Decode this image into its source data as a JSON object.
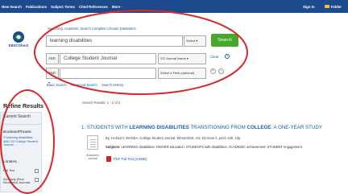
{
  "topnav": {
    "items": [
      "New Search",
      "Publications",
      "Subject Terms",
      "Cited References",
      "More ·"
    ],
    "sign_in": "Sign In",
    "folder": "Folder"
  },
  "logo": {
    "text": "EBSCOhost"
  },
  "search": {
    "searching_label": "Searching:",
    "databases": "Academic Search Complete",
    "choose_databases": "Choose Databases",
    "row1": {
      "value": "learning disabilities",
      "field": "Select a Field (optional)",
      "field_short": "Select ▾"
    },
    "row2": {
      "operator": "AND ▾",
      "value": "College Student Journal",
      "field": "SO Journal Name ▾"
    },
    "row3": {
      "operator": "AND ▾",
      "value": "",
      "field": "Select a Field (optional)"
    },
    "search_button": "Search",
    "clear": "Clear",
    "help": "?",
    "plus": "+",
    "minus": "−",
    "links": [
      "Basic Search",
      "Advanced Search",
      "Search History ·"
    ]
  },
  "refine": {
    "title": "Refine Results",
    "current_search": "Current Search",
    "boolean_head": "Boolean/Phrase:",
    "boolean_text": "TI learning disabilities AND SO College Student Journal",
    "limiters_head": "Limiters",
    "limiters": [
      "Full Text",
      "Scholarly (Peer Reviewed) Journals"
    ]
  },
  "results": {
    "count": "Search Results: 1 - 2 of 2",
    "item": {
      "number": "1.",
      "title_a": "STUDENTS WITH ",
      "title_b": "LEARNING DISABILITIES",
      "title_c": " TRANSITIONING FROM ",
      "title_d": "COLLEGE",
      "title_e": ": A ONE-YEAR STUDY",
      "by": "By: HADLEY, WANDA. College Student Journal. Winter2019, Vol. 53 Issue 4, p421-430. 10p.",
      "subjects_label": "Subjects:",
      "subjects": "LEARNING disabilities; HIGHER education; STUDENTS with disabilities; ACADEMIC achievement; STUDENT engagement",
      "doc_type": "Academic Journal",
      "pdf": "PDF Full Text",
      "pdf_size": "(4.6MB)"
    }
  },
  "colors": {
    "nav": "#1c4a8c",
    "accent": "#47a82e",
    "link": "#1a5ea8",
    "annotation": "#d9272e"
  }
}
